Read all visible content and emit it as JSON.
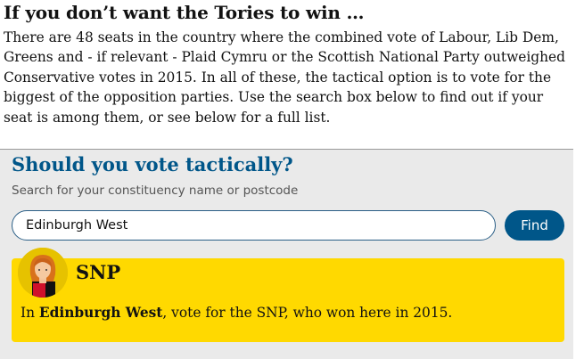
{
  "article": {
    "headline": "If you don’t want the Tories to win …",
    "intro": "There are 48 seats in the country where the combined vote of Labour, Lib Dem, Greens and - if relevant - Plaid Cymru or the Scottish National Party outweighed Conservative votes in 2015. In all of these, the tactical option is to vote for the biggest of the opposition parties. Use the search box below to find out if your seat is among them, or see below for a full list."
  },
  "widget": {
    "title": "Should you vote tactically?",
    "search_label": "Search for your constituency name or postcode",
    "search_value": "Edinburgh West",
    "find_button": "Find"
  },
  "result": {
    "party": "SNP",
    "avatar_icon": "snp-candidate-avatar-icon",
    "text_prefix": "In ",
    "constituency": "Edinburgh West",
    "text_suffix": ", vote for the SNP, who won here in 2015."
  },
  "colors": {
    "accent_blue": "#005689",
    "result_yellow": "#ffd900",
    "widget_background": "#eaeaea"
  }
}
